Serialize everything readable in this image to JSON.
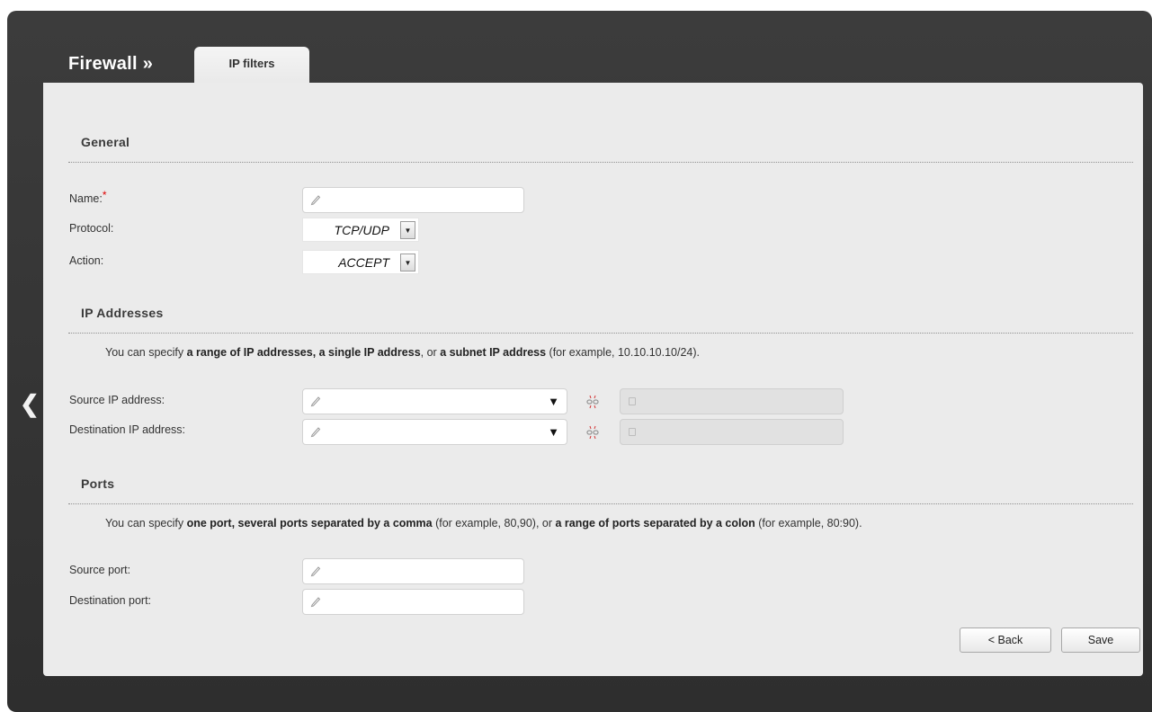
{
  "header": {
    "title": "Firewall »",
    "tab_label": "IP filters"
  },
  "general": {
    "title": "General",
    "name_label": "Name:",
    "required_mark": "*",
    "name_value": "",
    "protocol_label": "Protocol:",
    "protocol_value": "TCP/UDP",
    "action_label": "Action:",
    "action_value": "ACCEPT"
  },
  "ip_addresses": {
    "title": "IP Addresses",
    "hint_prefix": "You can specify ",
    "hint_b1": "a range of IP addresses, a single IP address",
    "hint_mid": ", or ",
    "hint_b2": "a subnet IP address",
    "hint_suffix": " (for example, 10.10.10.10/24).",
    "source_label": "Source IP address:",
    "source_value": "",
    "source_range_value": "",
    "dest_label": "Destination IP address:",
    "dest_value": "",
    "dest_range_value": ""
  },
  "ports": {
    "title": "Ports",
    "hint_prefix": "You can specify ",
    "hint_b1": "one port, several ports separated by a comma",
    "hint_mid": " (for example, 80,90), or ",
    "hint_b2": "a range of ports separated by a colon",
    "hint_suffix": " (for example, 80:90).",
    "source_label": "Source port:",
    "source_value": "",
    "dest_label": "Destination port:",
    "dest_value": ""
  },
  "buttons": {
    "back_label": "< Back",
    "save_label": "Save"
  },
  "icons": {
    "back_arrow": "chevron-left-icon",
    "field_edit": "pencil-icon",
    "range_link": "unlink-icon",
    "disabled_field": "lock-icon",
    "dropdown": "caret-down-icon"
  },
  "colors": {
    "frame": "#333333",
    "panel": "#ebebeb",
    "required": "#e00000"
  }
}
